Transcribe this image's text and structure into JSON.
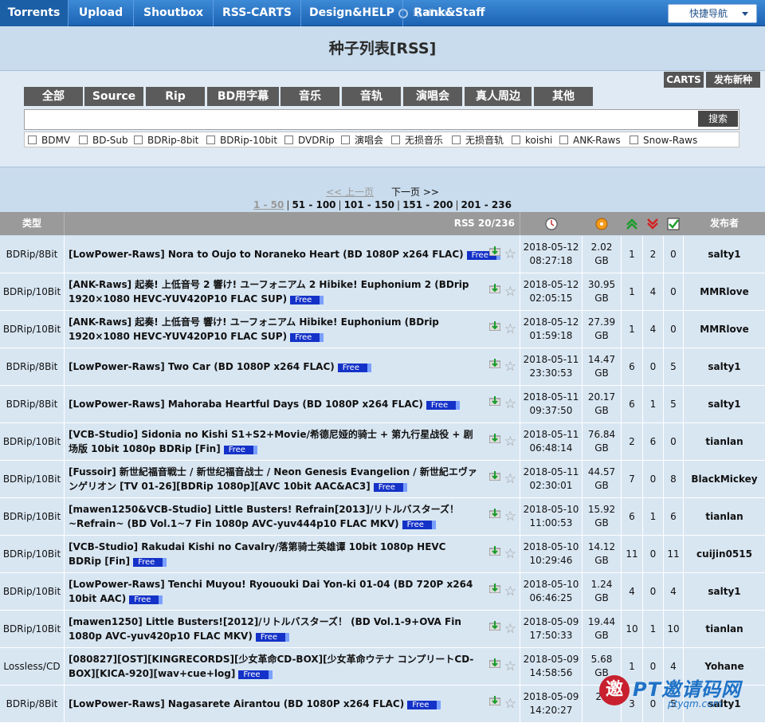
{
  "nav": {
    "items": [
      "Torrents",
      "Upload",
      "Shoutbox",
      "RSS-CARTS",
      "Design&HELP",
      "Rank&Staff"
    ],
    "ghost_text": "站  discuz",
    "quick_nav": "快捷导航"
  },
  "header": {
    "title": "种子列表[RSS]"
  },
  "toolbar": {
    "carts": "CARTS",
    "new_torrent": "发布新种"
  },
  "categories": [
    "全部",
    "Source",
    "Rip",
    "BD用字幕",
    "音乐",
    "音轨",
    "演唱会",
    "真人周边",
    "其他"
  ],
  "search": {
    "button": "搜索",
    "value": ""
  },
  "filters": [
    "BDMV",
    "BD-Sub",
    "BDRip-8bit",
    "BDRip-10bit",
    "DVDRip",
    "演唱会",
    "无损音乐",
    "无损音轨",
    "koishi",
    "ANK-Raws",
    "Snow-Raws"
  ],
  "pager": {
    "prev": "<< 上一页",
    "next": "下一页 >>",
    "pages": [
      "1 - 50",
      "51 - 100",
      "101 - 150",
      "151 - 200",
      "201 - 236"
    ]
  },
  "table": {
    "col_type": "类型",
    "col_rss": "RSS 20/236",
    "col_user": "发布者",
    "free_label": "Free",
    "rows": [
      {
        "type": "BDRip/8Bit",
        "title": "[LowPower-Raws] Nora to Oujo to Noraneko Heart (BD 1080P x264 FLAC)",
        "date": "2018-05-12",
        "time": "08:27:18",
        "size": "2.02",
        "unit": "GB",
        "seed": "1",
        "leech": "2",
        "done": "0",
        "user": "salty1"
      },
      {
        "type": "BDRip/10Bit",
        "title": "[ANK-Raws] 起奏! 上低音号 2 響け! ユーフォニアム 2 Hibike! Euphonium 2 (BDrip 1920×1080 HEVC-YUV420P10 FLAC SUP)",
        "date": "2018-05-12",
        "time": "02:05:15",
        "size": "30.95",
        "unit": "GB",
        "seed": "1",
        "leech": "4",
        "done": "0",
        "user": "MMRlove"
      },
      {
        "type": "BDRip/10Bit",
        "title": "[ANK-Raws] 起奏! 上低音号 響け! ユーフォニアム Hibike! Euphonium (BDrip 1920×1080 HEVC-YUV420P10 FLAC SUP)",
        "date": "2018-05-12",
        "time": "01:59:18",
        "size": "27.39",
        "unit": "GB",
        "seed": "1",
        "leech": "4",
        "done": "0",
        "user": "MMRlove"
      },
      {
        "type": "BDRip/8Bit",
        "title": "[LowPower-Raws] Two Car (BD 1080P x264 FLAC)",
        "date": "2018-05-11",
        "time": "23:30:53",
        "size": "14.47",
        "unit": "GB",
        "seed": "6",
        "leech": "0",
        "done": "5",
        "user": "salty1"
      },
      {
        "type": "BDRip/8Bit",
        "title": "[LowPower-Raws] Mahoraba Heartful Days (BD 1080P x264 FLAC)",
        "date": "2018-05-11",
        "time": "09:37:50",
        "size": "20.17",
        "unit": "GB",
        "seed": "6",
        "leech": "1",
        "done": "5",
        "user": "salty1"
      },
      {
        "type": "BDRip/10Bit",
        "title": "[VCB-Studio] Sidonia no Kishi S1+S2+Movie/希德尼娅的骑士 + 第九行星战役 + 剧场版 10bit 1080p BDRip [Fin]",
        "date": "2018-05-11",
        "time": "06:48:14",
        "size": "76.84",
        "unit": "GB",
        "seed": "2",
        "leech": "6",
        "done": "0",
        "user": "tianlan"
      },
      {
        "type": "BDRip/10Bit",
        "title": "[Fussoir] 新世紀福音戦士 / 新世纪福音战士 / Neon Genesis Evangelion / 新世紀エヴァンゲリオン [TV 01-26][BDRip 1080p][AVC 10bit AAC&AC3]",
        "date": "2018-05-11",
        "time": "02:30:01",
        "size": "44.57",
        "unit": "GB",
        "seed": "7",
        "leech": "0",
        "done": "8",
        "user": "BlackMickey"
      },
      {
        "type": "BDRip/10Bit",
        "title": "[mawen1250&VCB-Studio] Little Busters! Refrain[2013]/リトルバスターズ！~Refrain~ (BD Vol.1~7 Fin 1080p AVC-yuv444p10 FLAC MKV)",
        "date": "2018-05-10",
        "time": "11:00:53",
        "size": "15.92",
        "unit": "GB",
        "seed": "6",
        "leech": "1",
        "done": "6",
        "user": "tianlan"
      },
      {
        "type": "BDRip/10Bit",
        "title": "[VCB-Studio] Rakudai Kishi no Cavalry/落第骑士英雄谭 10bit 1080p HEVC BDRip [Fin]",
        "date": "2018-05-10",
        "time": "10:29:46",
        "size": "14.12",
        "unit": "GB",
        "seed": "11",
        "leech": "0",
        "done": "11",
        "user": "cuijin0515"
      },
      {
        "type": "BDRip/10Bit",
        "title": "[LowPower-Raws] Tenchi Muyou! Ryououki Dai Yon-ki 01-04 (BD 720P x264 10bit AAC)",
        "date": "2018-05-10",
        "time": "06:46:25",
        "size": "1.24",
        "unit": "GB",
        "seed": "4",
        "leech": "0",
        "done": "4",
        "user": "salty1"
      },
      {
        "type": "BDRip/10Bit",
        "title": "[mawen1250] Little Busters![2012]/リトルバスターズ！ (BD Vol.1-9+OVA Fin 1080p AVC-yuv420p10 FLAC MKV)",
        "date": "2018-05-09",
        "time": "17:50:33",
        "size": "19.44",
        "unit": "GB",
        "seed": "10",
        "leech": "1",
        "done": "10",
        "user": "tianlan"
      },
      {
        "type": "Lossless/CD",
        "title": "[080827][OST][KINGRECORDS][少女革命CD-BOX][少女革命ウテナ コンプリートCD-BOX][KICA-920][wav+cue+log]",
        "date": "2018-05-09",
        "time": "14:58:56",
        "size": "5.68",
        "unit": "GB",
        "seed": "1",
        "leech": "0",
        "done": "4",
        "user": "Yohane"
      },
      {
        "type": "BDRip/8Bit",
        "title": "[LowPower-Raws] Nagasarete Airantou (BD 1080P x264 FLAC)",
        "date": "2018-05-09",
        "time": "14:20:27",
        "size": "25",
        "unit": "",
        "seed": "3",
        "leech": "0",
        "done": "5",
        "user": "salty1"
      }
    ]
  },
  "watermark": {
    "mark": "邀",
    "title": "PT邀请码网",
    "url": "ptyqm.com"
  },
  "colors": {
    "nav": "#1d63b4",
    "free_badge": "#1432c8",
    "row_bg": "#d8e6f2",
    "header_bg": "#9a9a9a"
  }
}
